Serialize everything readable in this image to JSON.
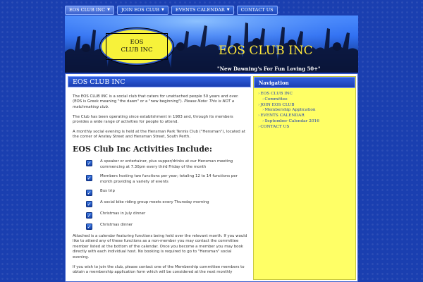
{
  "topnav": [
    {
      "label": "EOS CLUB INC",
      "dropdown": true
    },
    {
      "label": "JOIN EOS CLUB",
      "dropdown": true
    },
    {
      "label": "EVENTS CALENDAR",
      "dropdown": true
    },
    {
      "label": "CONTACT US",
      "dropdown": false
    }
  ],
  "header": {
    "logo_line1": "EOS",
    "logo_line2": "CLUB INC",
    "site_title": "EOS CLUB INC",
    "tagline": "\"New Dawning's For Fun Loving 50+\""
  },
  "main": {
    "title": "EOS CLUB INC",
    "para1": "The EOS CLUB INC is a social club that caters for unattached people 50 years and over. (EOS is Greek meaning \"the dawn\" or a \"new beginning\").",
    "para1_note": "Please Note:  This is NOT a matchmaking club.",
    "para2": "The Club has been operating since establishment in 1983 and, through its members provides a wide range of activities for people to attend.",
    "para3": "A monthly social evening is held at the Hensman Park Tennis Club (\"Hensman\"), located at the corner of Anstey Street and Hensman Street, South Perth.",
    "activities_heading": "EOS Club Inc Activities Include:",
    "activities": [
      "A speaker or entertainer, plus supper/drinks at our Hensman meeting commencing at 7.30pm every third Friday of the month",
      "Members hosting two functions per year; totaling 12 to 14 functions per month providing a variety of events",
      "Bus trip",
      "A social bike riding group meets every Thursday morning",
      "Christmas in July dinner",
      "Christmas dinner"
    ],
    "para4": "Attached is a calendar featuring functions being held over the relevant month.  If you would like to attend any of these functions as a non-member you may contact the committee member listed at the bottom of the calendar. Once you become a member you may book directly with each individual host.  No booking is required to go to \"Hensman\" social evening.",
    "para5": "If you wish to join the club, please contact one of the Membership committee members to obtain a membership application form which will be considered at the next monthly"
  },
  "sidebar": {
    "title": "Navigation",
    "links": [
      {
        "label": "EOS CLUB INC",
        "sub": false
      },
      {
        "label": "Committee",
        "sub": true
      },
      {
        "label": "JOIN EOS CLUB",
        "sub": false
      },
      {
        "label": "Membership Application",
        "sub": true
      },
      {
        "label": "EVENTS CALENDAR",
        "sub": false
      },
      {
        "label": "September Calendar 2016",
        "sub": true
      },
      {
        "label": "CONTACT US",
        "sub": false
      }
    ]
  },
  "colors": {
    "background": "#1a3fb0",
    "accent_yellow": "#ffff66",
    "title_yellow": "#ffe83a",
    "link_blue": "#1a3fb0"
  }
}
